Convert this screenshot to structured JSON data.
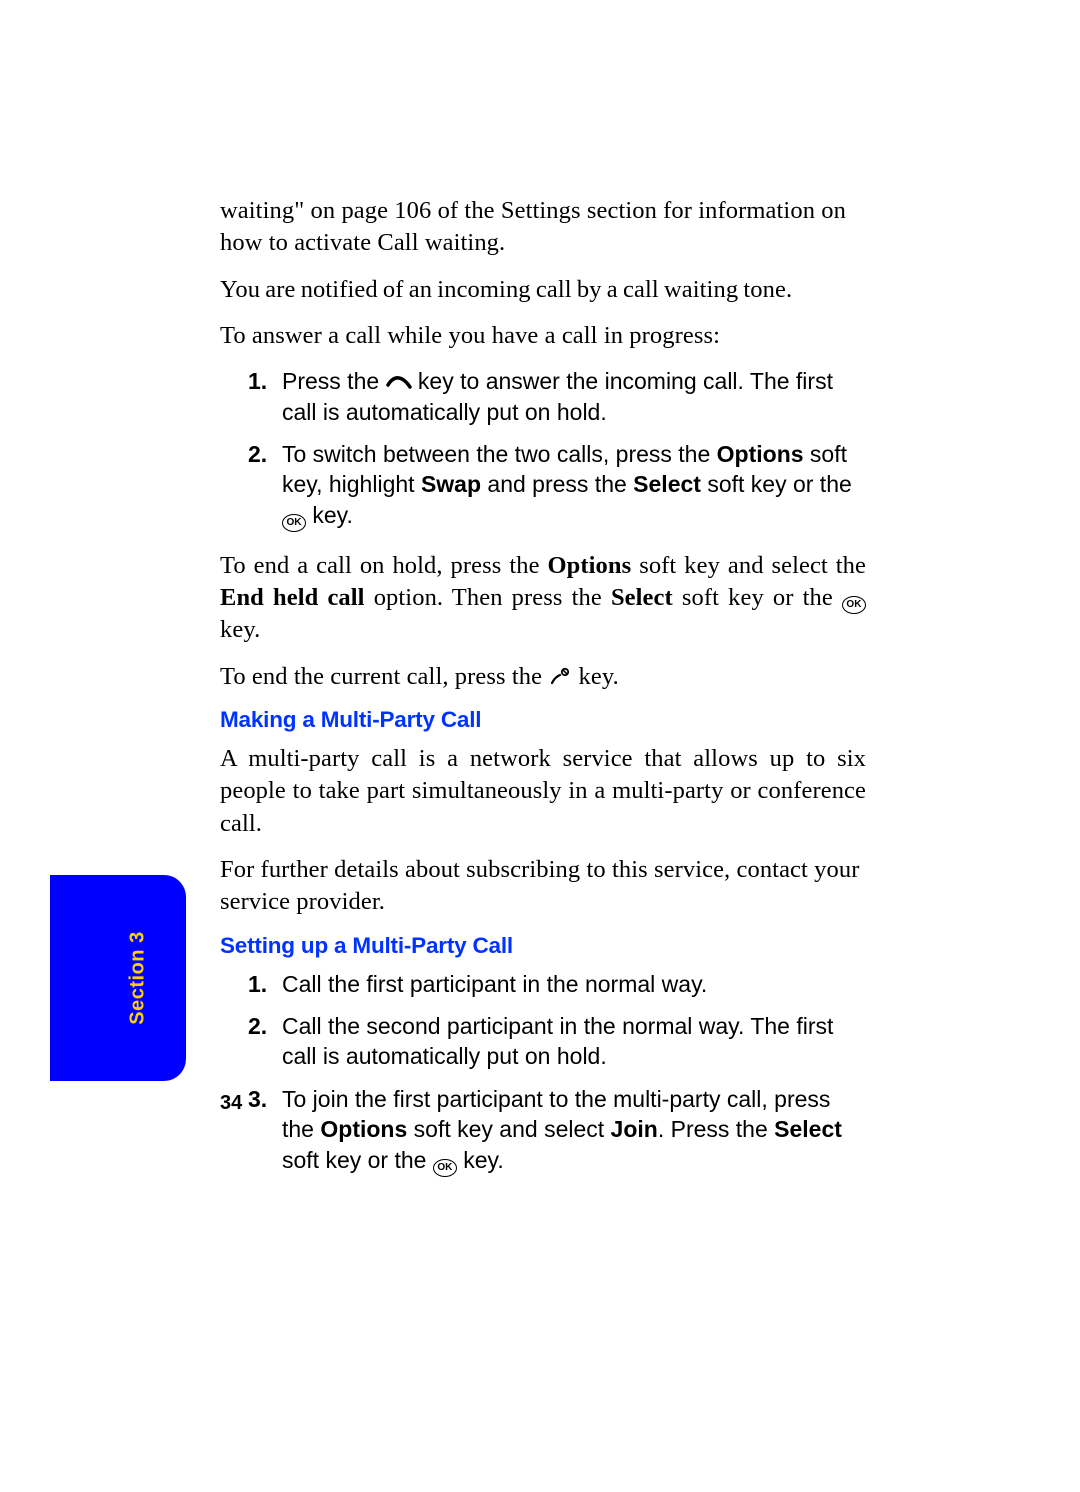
{
  "intro": {
    "p1": "waiting\" on page 106 of the Settings section for information on how to activate Call waiting.",
    "p2": "You are notified of an incoming call by a call waiting tone.",
    "p3": "To answer a call while you have a call in progress:"
  },
  "list1": {
    "m1": "1.",
    "i1a": "Press the ",
    "i1b": " key to answer the incoming call. The first call is automatically put on hold.",
    "m2": "2.",
    "i2a": "To switch between the two calls, press the ",
    "i2_b1": "Options",
    "i2b": " soft key, highlight ",
    "i2_b2": "Swap",
    "i2c": " and press the ",
    "i2_b3": "Select",
    "i2d": " soft key or the ",
    "i2e": " key."
  },
  "mid": {
    "p1a": "To end a call on hold, press the ",
    "p1_b1": "Options",
    "p1b": " soft key and select the ",
    "p1_b2": "End held call",
    "p1c": " option. Then press the ",
    "p1_b3": "Select",
    "p1d": " soft key or the ",
    "p1e": " key.",
    "p2a": "To end the current call, press the ",
    "p2b": " key."
  },
  "h1": "Making a Multi-Party Call",
  "multi": {
    "p1": "A multi-party call is a network service that allows up to six people to take part simultaneously in a multi-party or conference call.",
    "p2": "For further details about subscribing to this service, contact your service provider."
  },
  "h2": "Setting up a Multi-Party Call",
  "list2": {
    "m1": "1.",
    "i1": "Call the first participant in the normal way.",
    "m2": "2.",
    "i2": "Call the second participant in the normal way. The first call is automatically put on hold.",
    "m3": "3.",
    "i3a": "To join the first participant to the multi-party call, press the ",
    "i3_b1": "Options",
    "i3b": " soft key and select ",
    "i3_b2": "Join",
    "i3c": ". Press the ",
    "i3_b3": "Select",
    "i3d": " soft key or the ",
    "i3e": " key."
  },
  "tab_label": "Section 3",
  "ok_glyph": "OK",
  "page_number": "34"
}
